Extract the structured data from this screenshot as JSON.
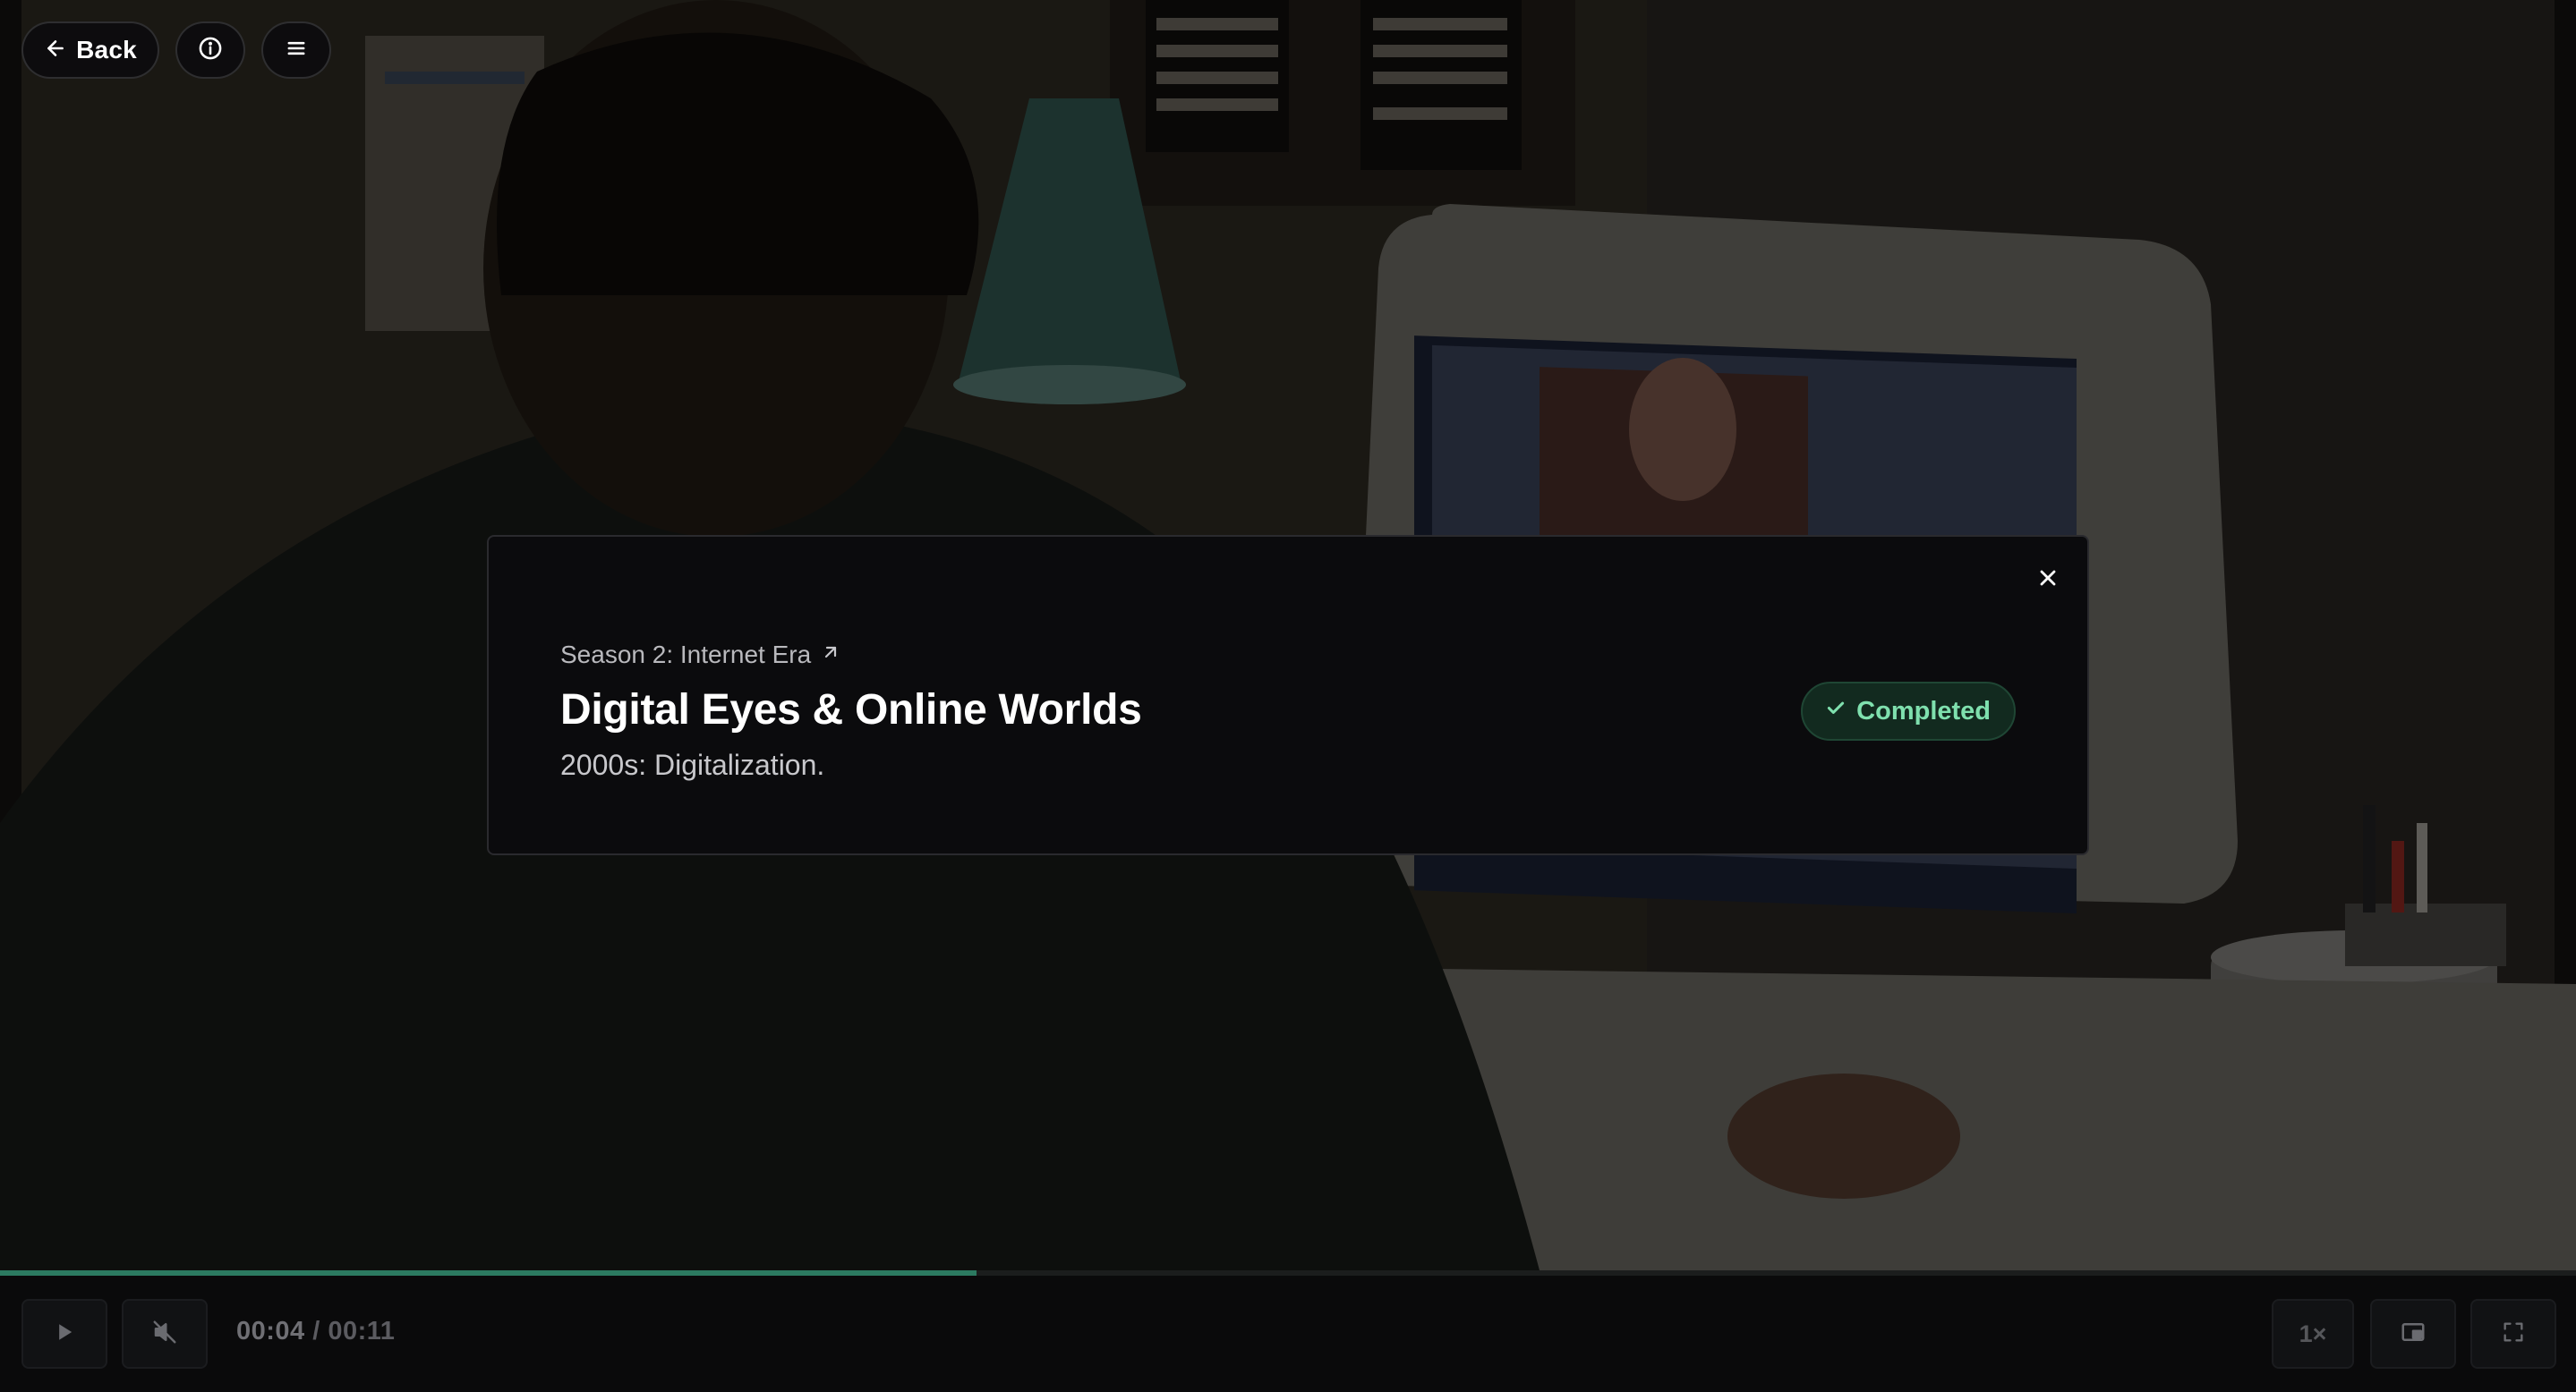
{
  "top_bar": {
    "back_label": "Back",
    "info_icon": "info-circle-icon",
    "menu_icon": "hamburger-menu-icon"
  },
  "modal": {
    "season_link": "Season 2: Internet Era",
    "season_link_icon": "arrow-up-right-icon",
    "title": "Digital Eyes & Online Worlds",
    "description": "2000s: Digitalization.",
    "status": "Completed",
    "status_icon": "check-icon",
    "close_icon": "close-icon"
  },
  "player": {
    "current_time": "00:04",
    "separator": " / ",
    "duration": "00:11",
    "progress_fraction": 0.379,
    "speed": "1×",
    "play_icon": "play-icon",
    "mute_icon": "muted-speaker-icon",
    "pip_icon": "picture-in-picture-icon",
    "fullscreen_icon": "fullscreen-icon"
  },
  "colors": {
    "accent_progress": "#2c7a61",
    "status_green": "#7fe0ae",
    "modal_bg": "#0b0b0d"
  }
}
